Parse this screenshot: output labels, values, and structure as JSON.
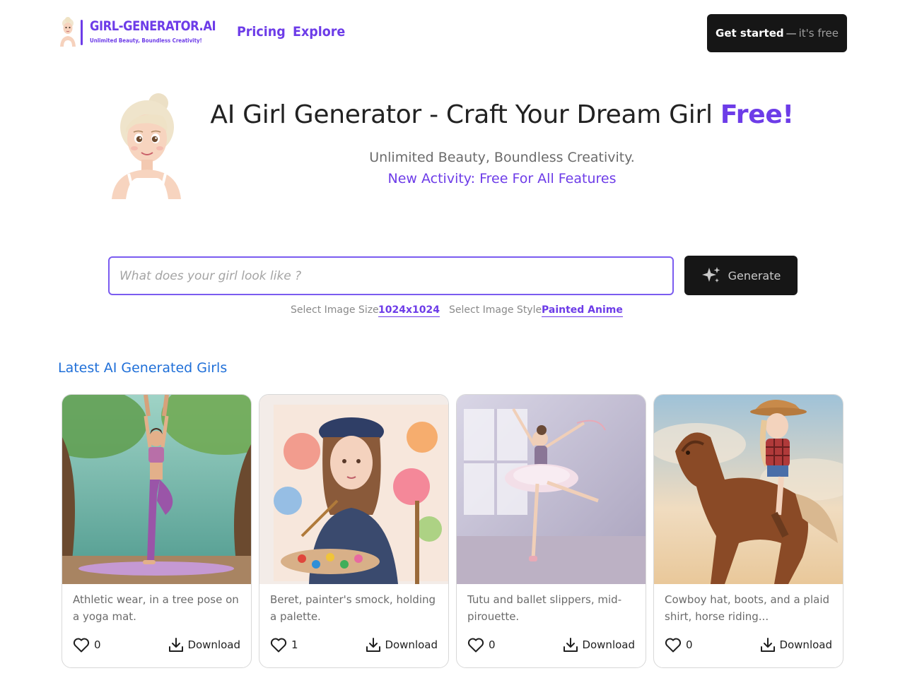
{
  "brand": {
    "title": "GIRL-GENERATOR.AI",
    "tagline": "Unlimited Beauty, Boundless Creativity!"
  },
  "nav": {
    "pricing": "Pricing",
    "explore": "Explore"
  },
  "cta": {
    "main": "Get started",
    "separator": "—",
    "secondary": "it's free"
  },
  "hero": {
    "title_main": "AI Girl Generator - Craft Your Dream Girl",
    "title_accent": "Free!",
    "subtitle": "Unlimited Beauty, Boundless Creativity.",
    "activity": "New Activity: Free For All Features"
  },
  "prompt": {
    "placeholder": "What does your girl look like ?",
    "generate_label": "Generate",
    "size_label": "Select Image Size",
    "size_value": "1024x1024",
    "style_label": "Select Image Style",
    "style_value": "Painted Anime"
  },
  "gallery": {
    "title": "Latest AI Generated Girls",
    "download_label": "Download",
    "cards": [
      {
        "description": "Athletic wear, in a tree pose on a yoga mat.",
        "likes": "0"
      },
      {
        "description": "Beret, painter's smock, holding a palette.",
        "likes": "1"
      },
      {
        "description": "Tutu and ballet slippers, mid-pirouette.",
        "likes": "0"
      },
      {
        "description": "Cowboy hat, boots, and a plaid shirt, horse riding...",
        "likes": "0"
      }
    ]
  },
  "colors": {
    "accent": "#6d3ce8",
    "section_title": "#1f6fd8",
    "button_dark": "#161616"
  },
  "icons": {
    "generate": "sparkle-icon",
    "like": "heart-icon",
    "download": "download-icon"
  }
}
